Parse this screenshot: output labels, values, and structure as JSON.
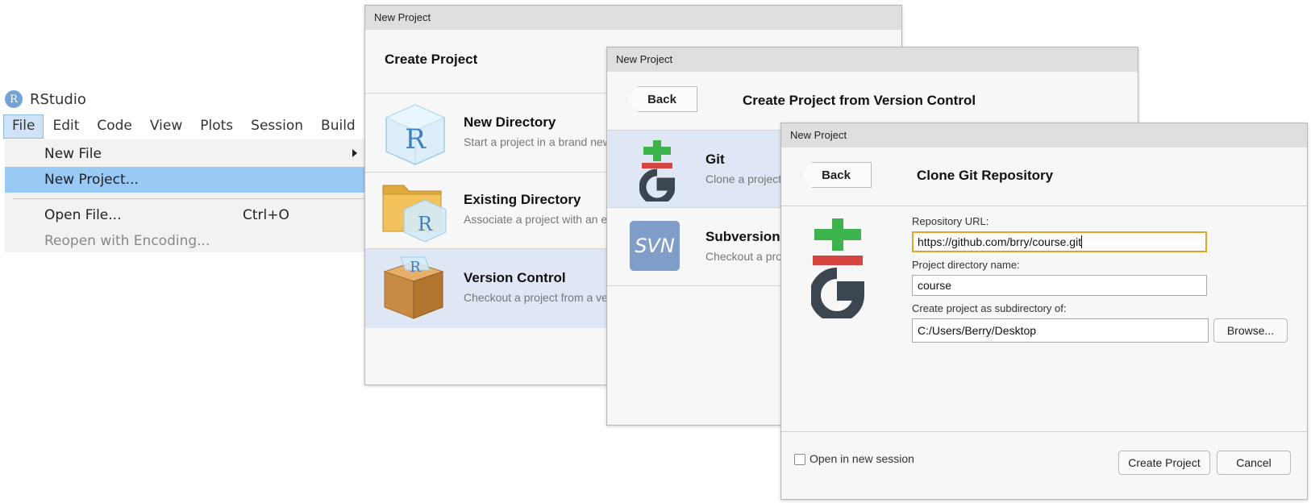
{
  "rstudio": {
    "app_name": "RStudio",
    "logo_letter": "R",
    "menubar": [
      "File",
      "Edit",
      "Code",
      "View",
      "Plots",
      "Session",
      "Build"
    ],
    "file_menu": {
      "new_file": "New File",
      "new_project": "New Project...",
      "open_file": "Open File...",
      "open_file_shortcut": "Ctrl+O",
      "reopen": "Reopen with Encoding..."
    }
  },
  "dialog1": {
    "window_title": "New Project",
    "header": "Create Project",
    "options": [
      {
        "title": "New Directory",
        "subtitle": "Start a project in a brand new working directory",
        "icon": "r-cube-icon"
      },
      {
        "title": "Existing Directory",
        "subtitle": "Associate a project with an existing working directory",
        "icon": "folder-r-icon"
      },
      {
        "title": "Version Control",
        "subtitle": "Checkout a project from a version control repository",
        "icon": "box-icon"
      }
    ]
  },
  "dialog2": {
    "window_title": "New Project",
    "back_label": "Back",
    "header": "Create Project from Version Control",
    "options": [
      {
        "title": "Git",
        "subtitle": "Clone a project from a Git repository",
        "icon": "git-icon"
      },
      {
        "title": "Subversion",
        "subtitle": "Checkout a project from a Subversion repository",
        "icon": "svn-icon",
        "icon_text": "SVN"
      }
    ]
  },
  "dialog3": {
    "window_title": "New Project",
    "back_label": "Back",
    "header": "Clone Git Repository",
    "repo_url_label": "Repository URL:",
    "repo_url_value": "https://github.com/brry/course.git",
    "dir_name_label": "Project directory name:",
    "dir_name_value": "course",
    "subdir_label": "Create project as subdirectory of:",
    "subdir_value": "C:/Users/Berry/Desktop",
    "browse_label": "Browse...",
    "open_new_session_label": "Open in new session",
    "create_label": "Create Project",
    "cancel_label": "Cancel"
  },
  "colors": {
    "menu_highlight": "#99c9f5",
    "selected_option": "#dfe7f4",
    "git_green": "#3cb44b",
    "git_red": "#d64541",
    "git_dark": "#3c4650",
    "svn_blue": "#809dc9",
    "focus_orange": "#e3a52a"
  }
}
